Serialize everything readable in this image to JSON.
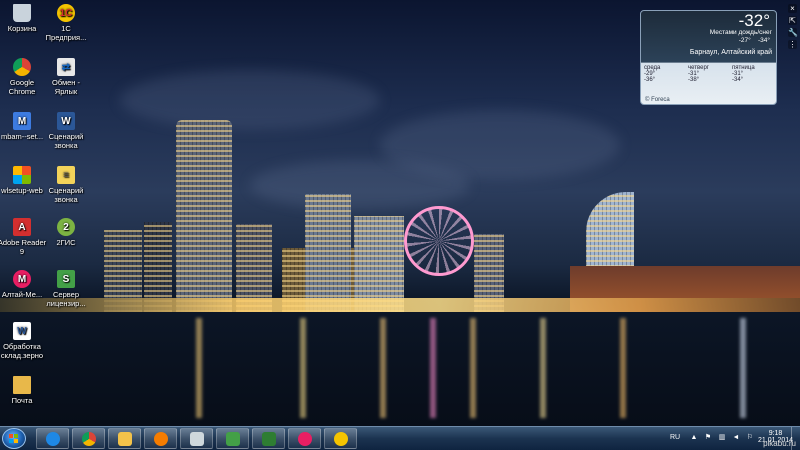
{
  "desktop": {
    "icons": [
      {
        "label": "Корзина",
        "icon": "recycle-bin-icon",
        "color": "#c9d3dc"
      },
      {
        "label": "1С Предприя...",
        "icon": "1c-enterprise-icon",
        "color": "#f5c400"
      },
      {
        "label": "Google Chrome",
        "icon": "chrome-icon",
        "color": "#db4437"
      },
      {
        "label": "Обмен - Ярлык",
        "icon": "exchange-shortcut-icon",
        "color": "#e8e8e8"
      },
      {
        "label": "mbam--set...",
        "icon": "malwarebytes-setup-icon",
        "color": "#3d7be0"
      },
      {
        "label": "Сценарий звонка",
        "icon": "word-document-icon",
        "color": "#2b5797"
      },
      {
        "label": "wlsetup-web",
        "icon": "windows-live-setup-icon",
        "color": "#1e88e5"
      },
      {
        "label": "Сценарий звонка",
        "icon": "text-document-icon",
        "color": "#f3d35a"
      },
      {
        "label": "Adobe Reader 9",
        "icon": "adobe-reader-icon",
        "color": "#d32f2f"
      },
      {
        "label": "2ГИС",
        "icon": "2gis-icon",
        "color": "#7cb342"
      },
      {
        "label": "Алтай-Ме...",
        "icon": "altai-media-icon",
        "color": "#e91e63"
      },
      {
        "label": "Сервер лицензир...",
        "icon": "license-server-icon",
        "color": "#43a047"
      },
      {
        "label": "Обработка склад.зерно",
        "icon": "processing-document-icon",
        "color": "#ffffff"
      },
      {
        "label": "Почта",
        "icon": "mail-folder-icon",
        "color": "#e8b84a"
      }
    ]
  },
  "gadget": {
    "temperature": "-32°",
    "condition": "Местами дождь/снег",
    "hi": "-27°",
    "lo": "-34°",
    "city": "Барнаул, Алтайский край",
    "brand": "© Foreca",
    "forecast": [
      {
        "day": "среда",
        "hi": "-29°",
        "lo": "-36°"
      },
      {
        "day": "четверг",
        "hi": "-31°",
        "lo": "-38°"
      },
      {
        "day": "пятница",
        "hi": "-31°",
        "lo": "-34°"
      }
    ],
    "tools": [
      "×",
      "⇱",
      "🔧",
      "⋮"
    ]
  },
  "taskbar": {
    "pinned": [
      {
        "name": "internet-explorer-icon",
        "color": "#1e88e5"
      },
      {
        "name": "chrome-icon",
        "color": "#db4437"
      },
      {
        "name": "explorer-folder-icon",
        "color": "#f3c24a"
      },
      {
        "name": "media-player-icon",
        "color": "#f57c00"
      },
      {
        "name": "notes-icon",
        "color": "#cfd8dc"
      },
      {
        "name": "remote-desktop-icon",
        "color": "#43a047"
      },
      {
        "name": "excel-icon",
        "color": "#2e7d32"
      },
      {
        "name": "altai-media-icon",
        "color": "#e91e63"
      },
      {
        "name": "1c-icon",
        "color": "#f5c400"
      }
    ],
    "tray": {
      "language": "RU",
      "time": "9:18",
      "date": "21.01.2014"
    }
  },
  "watermark": "pikabu.ru"
}
